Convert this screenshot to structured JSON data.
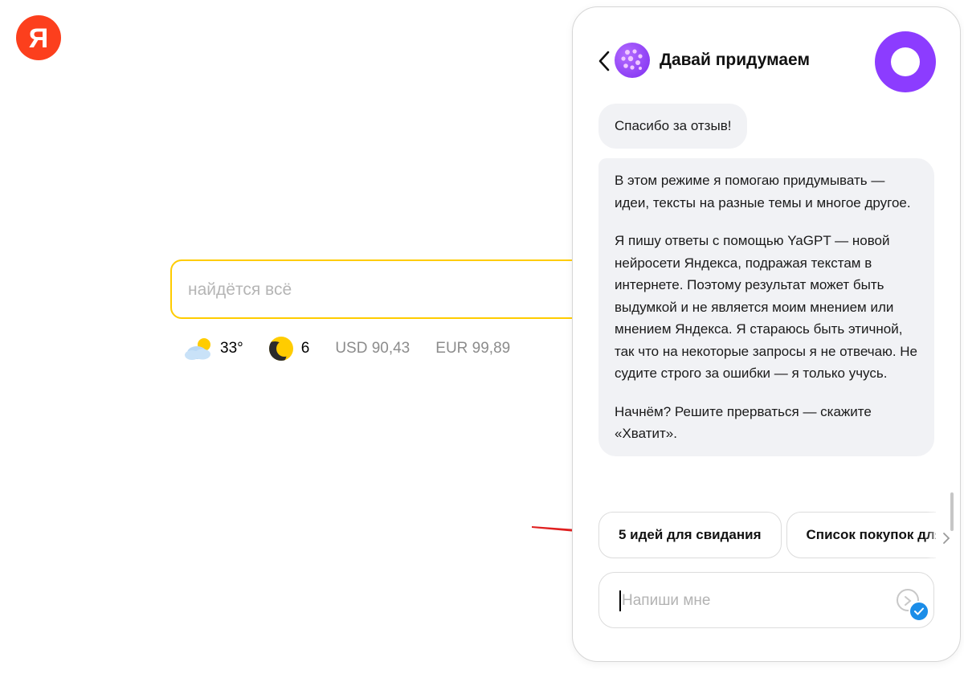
{
  "logo": {
    "letter": "Я",
    "color": "#fc3f1d"
  },
  "search": {
    "placeholder": "найдётся всё",
    "value": ""
  },
  "informers": {
    "weather": {
      "temp": "33°",
      "icon": "cloud-sun-icon"
    },
    "traffic": {
      "score": "6",
      "icon": "traffic-light-icon"
    },
    "usd": "USD 90,43",
    "eur": "EUR 99,89"
  },
  "chat": {
    "title": "Давай придумаем",
    "back_icon": "chevron-left-icon",
    "assistant_icon": "alice-icon",
    "messages": [
      {
        "text": "Спасибо за отзыв!"
      },
      {
        "paragraphs": [
          "В этом режиме я помогаю придумывать — идеи, тексты на разные темы и многое другое.",
          "Я пишу ответы с помощью YaGPT — новой нейросети Яндекса, подражая текстам в интернете. Поэтому результат может быть выдумкой и не является моим мнением или мнением Яндекса. Я стараюсь быть этичной, так что на некоторые запросы я не отвечаю. Не судите строго за ошибки — я только учусь.",
          "Начнём? Решите прерваться — скажите «Хватит»."
        ]
      }
    ],
    "suggestions": [
      {
        "label": "5 идей для свидания"
      },
      {
        "label": "Список покупок для"
      }
    ],
    "input": {
      "placeholder": "Напиши мне",
      "value": ""
    }
  },
  "colors": {
    "accent_yellow": "#ffcc00",
    "alice_purple": "#8c3cff",
    "bubble_bg": "#f1f2f5",
    "annotation_arrow": "#e02020"
  }
}
